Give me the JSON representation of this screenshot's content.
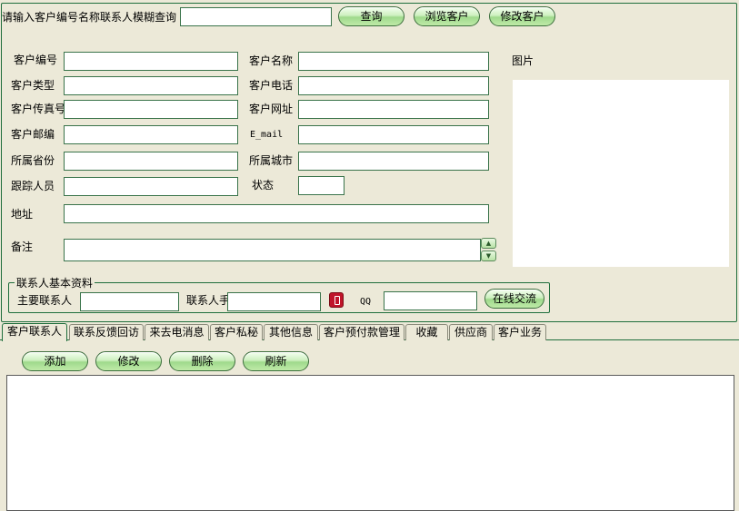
{
  "search": {
    "label": "请输入客户编号名称联系人模糊查询",
    "value": "",
    "query_button": "查询",
    "browse_button": "浏览客户",
    "modify_button": "修改客户"
  },
  "form": {
    "customer_id": {
      "label": "客户编号",
      "value": ""
    },
    "customer_name": {
      "label": "客户名称",
      "value": ""
    },
    "customer_type": {
      "label": "客户类型",
      "value": ""
    },
    "customer_phone": {
      "label": "客户电话",
      "value": ""
    },
    "customer_fax": {
      "label": "客户传真号",
      "value": ""
    },
    "customer_website": {
      "label": "客户网址",
      "value": ""
    },
    "customer_postcode": {
      "label": "客户邮编",
      "value": ""
    },
    "email": {
      "label": "E_mail",
      "value": ""
    },
    "province": {
      "label": "所属省份",
      "value": ""
    },
    "city": {
      "label": "所属城市",
      "value": ""
    },
    "tracker": {
      "label": "跟踪人员",
      "value": ""
    },
    "status": {
      "label": "状态",
      "value": ""
    },
    "address": {
      "label": "地址",
      "value": ""
    },
    "remark": {
      "label": "备注",
      "value": ""
    },
    "picture_label": "图片"
  },
  "contact": {
    "group_title": "联系人基本资料",
    "main_contact": {
      "label": "主要联系人",
      "value": ""
    },
    "contact_mobile": {
      "label": "联系人手",
      "value": ""
    },
    "qq": {
      "label": "QQ",
      "value": ""
    },
    "chat_button": "在线交流"
  },
  "tabs": [
    {
      "label": "客户联系人",
      "active": true
    },
    {
      "label": "联系反馈回访"
    },
    {
      "label": "来去电消息"
    },
    {
      "label": "客户私秘"
    },
    {
      "label": "其他信息"
    },
    {
      "label": "客户预付款管理"
    },
    {
      "label": "收藏"
    },
    {
      "label": "供应商"
    },
    {
      "label": "客户业务"
    }
  ],
  "toolbar": {
    "add": "添加",
    "edit": "修改",
    "delete": "删除",
    "refresh": "刷新"
  },
  "colors": {
    "background": "#ece9d8",
    "border": "#1f6e3c",
    "button_green": "#9fd98c",
    "phone_icon_red": "#c0152a"
  }
}
